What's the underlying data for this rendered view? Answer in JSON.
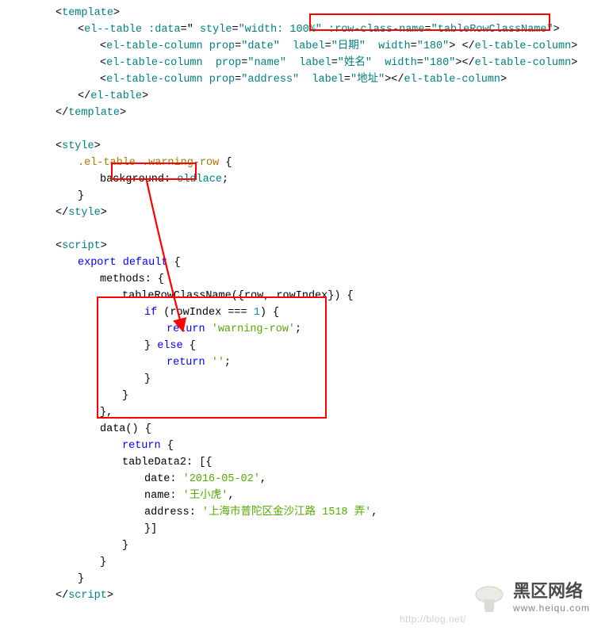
{
  "code": {
    "l1a": "<",
    "l1b": "template",
    "l1c": ">",
    "l2a": "<",
    "l2b": "el--table :data",
    "l2c": "=\"",
    "l2d": " style",
    "l2e": "=",
    "l2f": "\"width: 100%\"",
    "l2g": " :row-class-name",
    "l2h": "=",
    "l2i": "\"tableRowClassName\"",
    "l2j": ">",
    "l3a": "<",
    "l3b": "el-table-column prop",
    "l3c": "=",
    "l3d": "\"date\"",
    "l3e": "  label",
    "l3f": "=",
    "l3g": "\"日期\"",
    "l3h": "  width",
    "l3i": "=",
    "l3j": "\"180\"",
    "l3k": ">",
    "l3l": " </",
    "l3m": "el-table-column",
    "l3n": ">",
    "l4a": "<",
    "l4b": "el-table-column  prop",
    "l4c": "=",
    "l4d": "\"name\"",
    "l4e": "  label",
    "l4f": "=",
    "l4g": "\"姓名\"",
    "l4h": "  width",
    "l4i": "=",
    "l4j": "\"180\"",
    "l4k": "></",
    "l4l": "el-table-column",
    "l4m": ">",
    "l5a": "<",
    "l5b": "el-table-column prop",
    "l5c": "=",
    "l5d": "\"address\"",
    "l5e": "  label",
    "l5f": "=",
    "l5g": "\"地址\"",
    "l5h": "></",
    "l5i": "el-table-column",
    "l5j": ">",
    "l6a": "</",
    "l6b": "el-table",
    "l6c": ">",
    "l7a": "</",
    "l7b": "template",
    "l7c": ">",
    "l8a": "<",
    "l8b": "style",
    "l8c": ">",
    "l9a": ".el-table",
    "l9b": " .warning-row ",
    "l9c": "{",
    "l10a": "background",
    "l10b": ": ",
    "l10c": "oldlace",
    "l10d": ";",
    "l11a": "}",
    "l12a": "</",
    "l12b": "style",
    "l12c": ">",
    "l13a": "<",
    "l13b": "script",
    "l13c": ">",
    "l14a": "export ",
    "l14b": "default",
    "l14c": " {",
    "l15a": "methods: {",
    "l16a": "tableRowClassName({row, rowIndex}) {",
    "l17a": "if",
    "l17b": " (rowIndex === ",
    "l17c": "1",
    "l17d": ") {",
    "l18a": "return ",
    "l18b": "'warning-row'",
    "l18c": ";",
    "l19a": "} ",
    "l19b": "else",
    "l19c": " {",
    "l20a": "return ",
    "l20b": "''",
    "l20c": ";",
    "l21a": "}",
    "l22a": "}",
    "l23a": "},",
    "l24a": "data() {",
    "l25a": "return",
    "l25b": " {",
    "l26a": "tableData2: [{",
    "l27a": "date: ",
    "l27b": "'2016-05-02'",
    "l27c": ",",
    "l28a": "name: ",
    "l28b": "'王小虎'",
    "l28c": ",",
    "l29a": "address: ",
    "l29b": "'上海市普陀区金沙江路 1518 弄'",
    "l29c": ",",
    "l30a": "}]",
    "l31a": "}",
    "l32a": "}",
    "l33a": "}",
    "l34a": "</",
    "l34b": "script",
    "l34c": ">"
  },
  "watermark": {
    "title": "黑区网络",
    "sub": "www.heiqu.com",
    "faint": "http://blog.net/"
  }
}
